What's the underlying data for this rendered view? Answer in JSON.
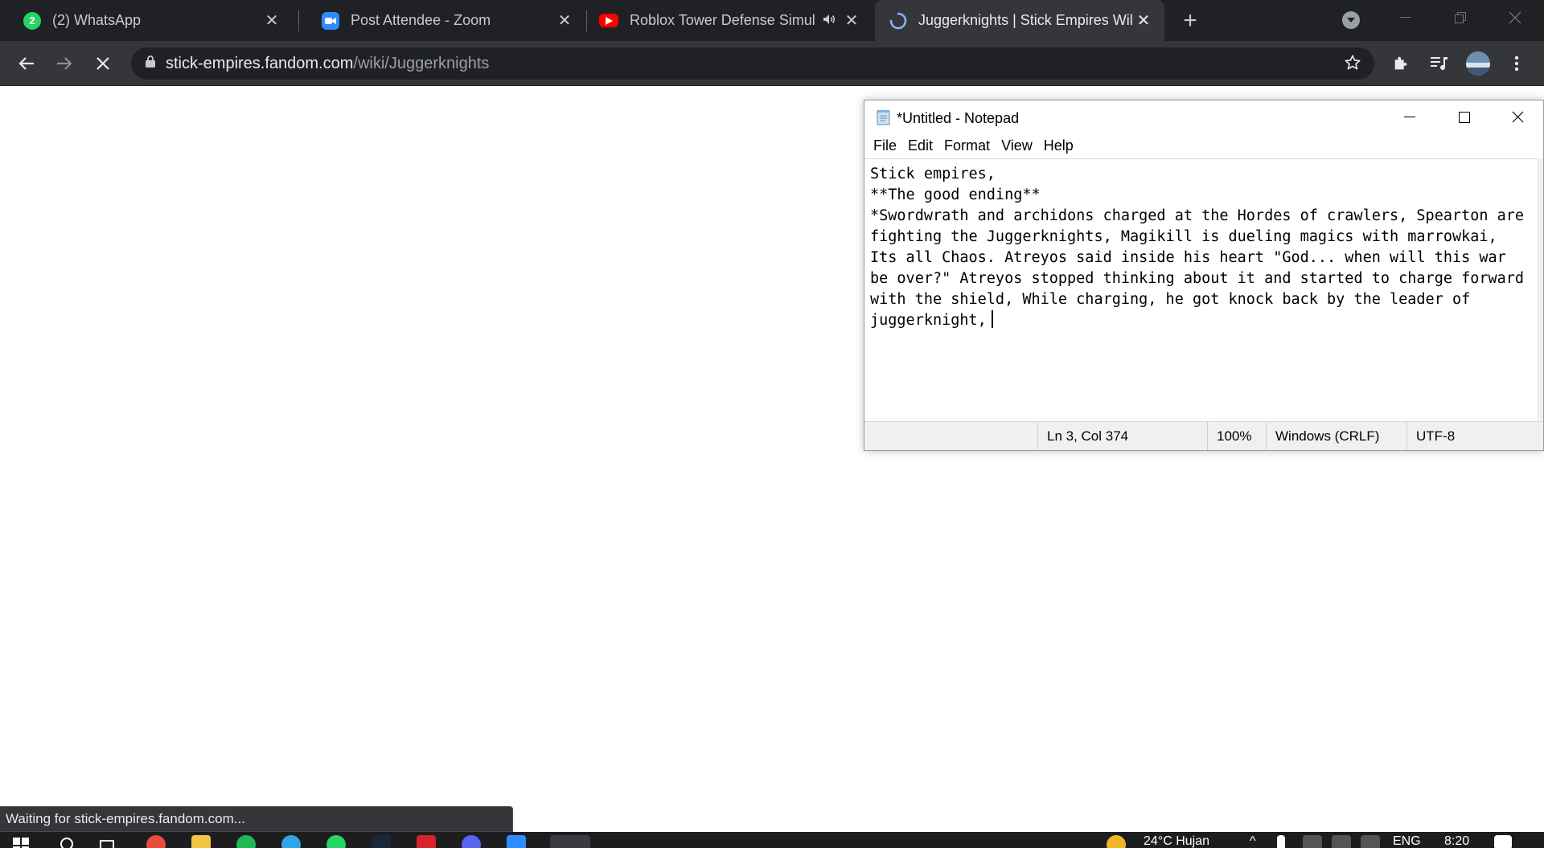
{
  "browser": {
    "tabs": [
      {
        "title": "(2) WhatsApp",
        "icon": "whatsapp-icon",
        "color": "#25d366",
        "badge": "2"
      },
      {
        "title": "Post Attendee - Zoom",
        "icon": "zoom-icon",
        "color": "#2d8cff"
      },
      {
        "title": "Roblox Tower Defense Simul",
        "icon": "youtube-icon",
        "color": "#ff0000"
      },
      {
        "title": "Juggerknights | Stick Empires Wil",
        "icon": "loading-spinner-icon",
        "color": "#8ab4f8"
      }
    ],
    "url_host": "stick-empires.fandom.com",
    "url_path": "/wiki/Juggerknights",
    "status_text": "Waiting for stick-empires.fandom.com..."
  },
  "notepad": {
    "title": "*Untitled - Notepad",
    "menu": [
      "File",
      "Edit",
      "Format",
      "View",
      "Help"
    ],
    "content": "Stick empires,\n**The good ending**\n*Swordwrath and archidons charged at the Hordes of crawlers, Spearton are fighting the Juggerknights, Magikill is dueling magics with marrowkai, Its all Chaos. Atreyos said inside his heart \"God... when will this war be over?\" Atreyos stopped thinking about it and started to charge forward with the shield, While charging, he got knock back by the leader of juggerknight,",
    "status": {
      "position": "Ln 3, Col 374",
      "zoom": "100%",
      "line_endings": "Windows (CRLF)",
      "encoding": "UTF-8"
    }
  },
  "taskbar": {
    "weather": "24°C  Hujan",
    "language": "ENG",
    "time": "8:20"
  }
}
